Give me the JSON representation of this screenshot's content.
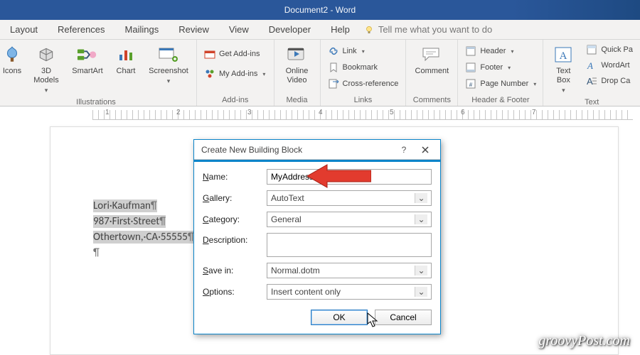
{
  "title": "Document2 - Word",
  "menu": [
    "Layout",
    "References",
    "Mailings",
    "Review",
    "View",
    "Developer",
    "Help"
  ],
  "tell_me": "Tell me what you want to do",
  "ribbon": {
    "illustrations": {
      "label": "Illustrations",
      "items": [
        "Icons",
        "3D Models",
        "SmartArt",
        "Chart",
        "Screenshot"
      ]
    },
    "addins": {
      "label": "Add-ins",
      "get": "Get Add-ins",
      "my": "My Add-ins"
    },
    "media": {
      "label": "Media",
      "item": "Online Video"
    },
    "links": {
      "label": "Links",
      "link": "Link",
      "bookmark": "Bookmark",
      "xref": "Cross-reference"
    },
    "comments": {
      "label": "Comments",
      "item": "Comment"
    },
    "hf": {
      "label": "Header & Footer",
      "header": "Header",
      "footer": "Footer",
      "pagenum": "Page Number"
    },
    "text": {
      "label": "Text",
      "box": "Text Box",
      "quick": "Quick Pa",
      "wordart": "WordArt",
      "drop": "Drop Ca"
    }
  },
  "ruler_nums": [
    "1",
    "2",
    "3",
    "4",
    "5",
    "6",
    "7"
  ],
  "doc_lines": [
    "Lori·Kaufman",
    "987·First·Street",
    "Othertown,·CA·55555"
  ],
  "dialog": {
    "title": "Create New Building Block",
    "labels": {
      "name": "Name:",
      "gallery": "Gallery:",
      "category": "Category:",
      "description": "Description:",
      "savein": "Save in:",
      "options": "Options:"
    },
    "values": {
      "name": "MyAddress",
      "gallery": "AutoText",
      "category": "General",
      "description": "",
      "savein": "Normal.dotm",
      "options": "Insert content only"
    },
    "ok": "OK",
    "cancel": "Cancel"
  },
  "watermark": "groovyPost.com"
}
